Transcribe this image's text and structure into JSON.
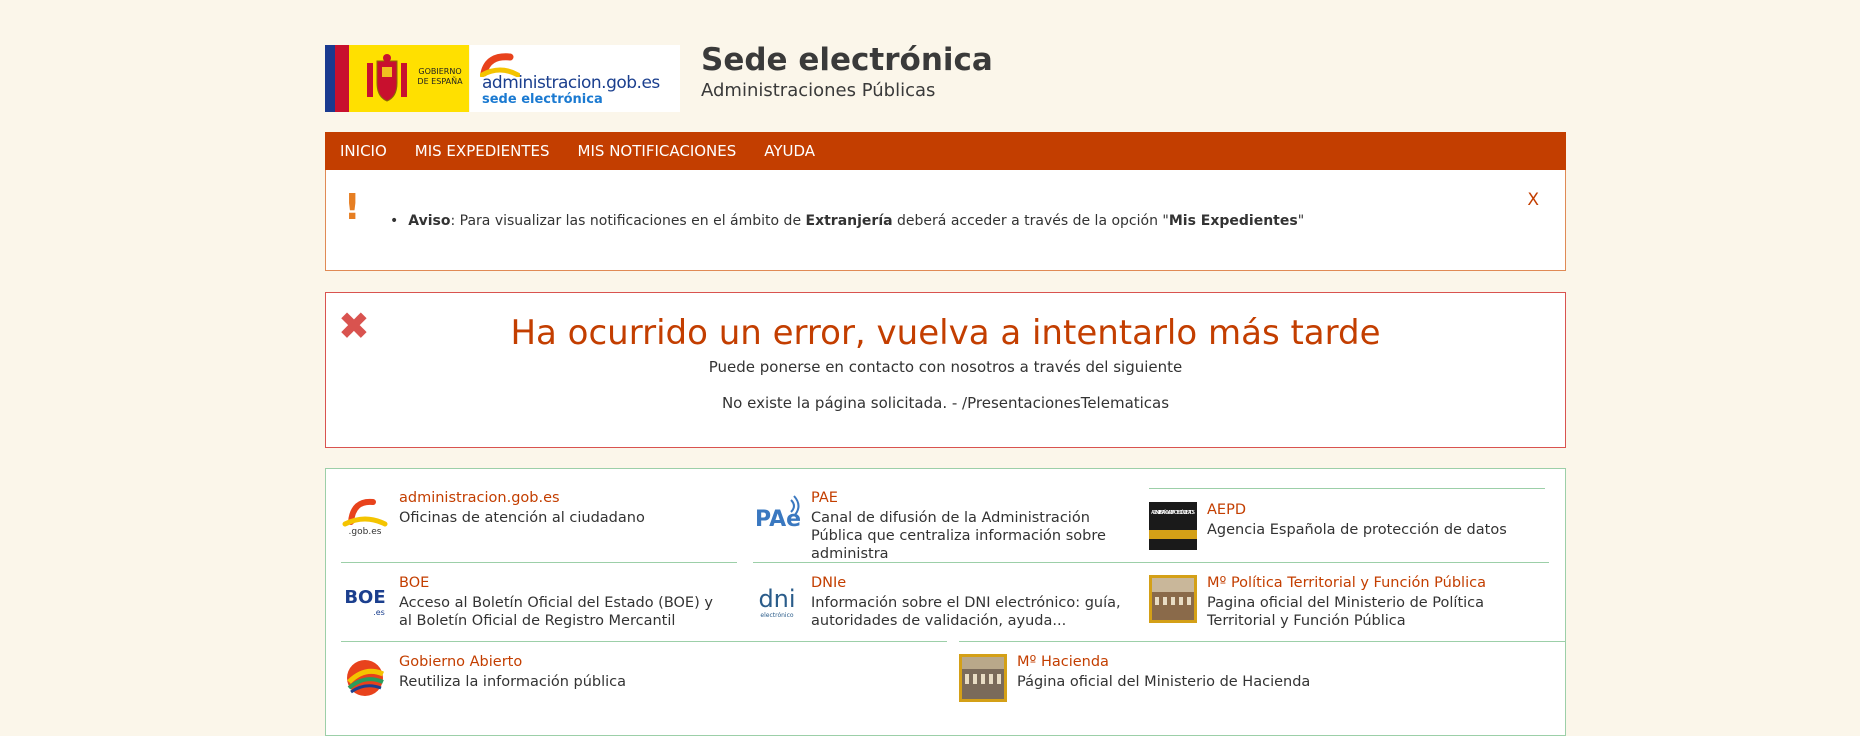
{
  "header": {
    "gob_logo_text": "GOBIERNO\nDE ESPAÑA",
    "adm_logo_name": "administracion.gob.es",
    "adm_logo_sub": "sede electrónica",
    "title": "Sede electrónica",
    "subtitle": "Administraciones Públicas"
  },
  "nav": {
    "items": [
      "INICIO",
      "MIS EXPEDIENTES",
      "MIS NOTIFICACIONES",
      "AYUDA"
    ]
  },
  "aviso": {
    "label": "Aviso",
    "text_1": ": Para visualizar las notificaciones en el ámbito de ",
    "bold_1": "Extranjería",
    "text_2": " deberá acceder a través de la opción \"",
    "bold_2": "Mis Expedientes",
    "text_3": "\"",
    "close_label": "X"
  },
  "error": {
    "title": "Ha ocurrido un error, vuelva a intentarlo más tarde",
    "line_1": "Puede ponerse en contacto con nosotros a través del siguiente",
    "line_2": "No existe la página solicitada. - /PresentacionesTelematicas"
  },
  "links": [
    {
      "title": "administracion.gob.es",
      "desc": "Oficinas de atención al ciudadano",
      "icon": "gobes-icon"
    },
    {
      "title": "PAE",
      "desc": "Canal de difusión de la Administración Pública que centraliza información sobre administra",
      "icon": "pae-icon"
    },
    {
      "title": "AEPD",
      "desc": "Agencia Española de protección de datos",
      "icon": "aepd-icon"
    },
    {
      "title": "BOE",
      "desc": "Acceso al Boletín Oficial del Estado (BOE) y al Boletín Oficial de Registro Mercantil",
      "icon": "boe-icon"
    },
    {
      "title": "DNIe",
      "desc": "Información sobre el DNI electrónico: guía, autoridades de validación, ayuda...",
      "icon": "dni-icon"
    },
    {
      "title": "Mº Política Territorial y Función Pública",
      "desc": "Pagina oficial del Ministerio de Política Territorial y Función Pública",
      "icon": "ministerio-icon"
    },
    {
      "title": "Gobierno Abierto",
      "desc": "Reutiliza la información pública",
      "icon": "gobierno-abierto-icon"
    },
    {
      "title": "Mº Hacienda",
      "desc": "Página oficial del Ministerio de Hacienda",
      "icon": "hacienda-icon"
    }
  ],
  "icon_text": {
    "gobes": ".gob.es",
    "pae": "PAe",
    "aepd": "AGENCIA ESPAÑOLA DE PROTECCIÓN DE DATOS",
    "boe": "BOE",
    "boe_sub": ".es",
    "dni": "dni",
    "dni_sub": "electrónico"
  },
  "colors": {
    "accent": "#c33e00",
    "background": "#fbf6ea",
    "error": "#d9534f",
    "links_border": "#9ccfa8"
  }
}
